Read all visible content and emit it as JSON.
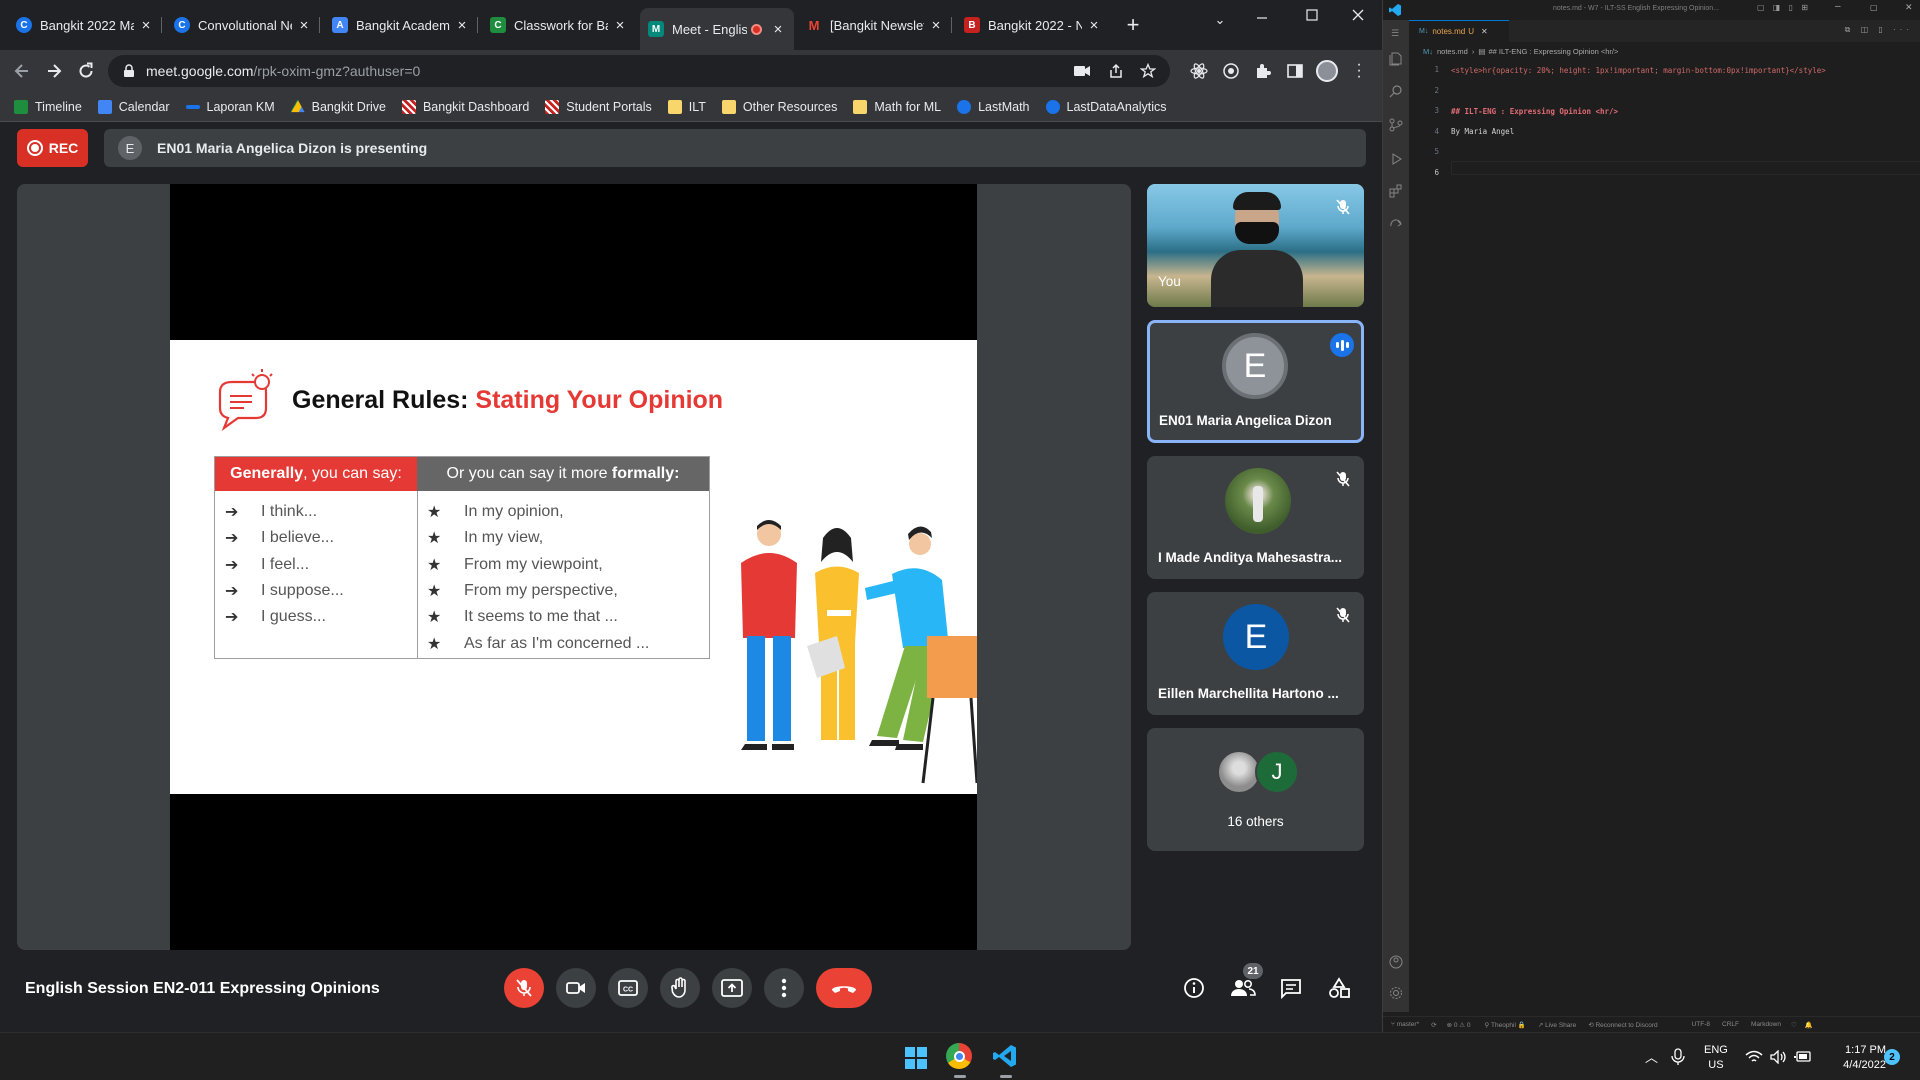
{
  "browser": {
    "tabs": [
      {
        "label": "Bangkit 2022 Ma...",
        "fav": "C",
        "color": "#1a73e8"
      },
      {
        "label": "Convolutional Ne...",
        "fav": "C",
        "color": "#1a73e8"
      },
      {
        "label": "Bangkit Academy...",
        "fav": "A",
        "color": "#4285f4"
      },
      {
        "label": "Classwork for Ba...",
        "fav": "C",
        "color": "#1e8e3e"
      },
      {
        "label": "Meet - Englis...",
        "fav": "M",
        "color": "#00897b"
      },
      {
        "label": "[Bangkit Newslet...",
        "fav": "M",
        "color": "#ea4335"
      },
      {
        "label": "Bangkit 2022 - N...",
        "fav": "B",
        "color": "#c5221f"
      }
    ],
    "url_host": "meet.google.com",
    "url_path": "/rpk-oxim-gmz?authuser=0",
    "bookmarks": [
      "Timeline",
      "Calendar",
      "Laporan KM",
      "Bangkit Drive",
      "Bangkit Dashboard",
      "Student Portals",
      "ILT",
      "Other Resources",
      "Math for ML",
      "LastMath",
      "LastDataAnalytics"
    ]
  },
  "meet": {
    "rec_label": "REC",
    "presenter_initial": "E",
    "presenting_text": "EN01 Maria Angelica Dizon is presenting",
    "meeting_title": "English Session EN2-011 Expressing Opinions",
    "people_count": "21",
    "participants": [
      {
        "name": "You"
      },
      {
        "name": "EN01 Maria Angelica Dizon",
        "initial": "E"
      },
      {
        "name": "I Made Anditya Mahesastra..."
      },
      {
        "name": "Eillen Marchellita Hartono ...",
        "initial": "E"
      },
      {
        "name": "16 others",
        "initial": "J"
      }
    ]
  },
  "slide": {
    "title_a": "General Rules:",
    "title_b": "Stating Your Opinion",
    "col1_head_bold": "Generally",
    "col1_head_rest": ", you can say:",
    "col2_head_pre": "Or you can say it more ",
    "col2_head_bold": "formally:",
    "col1_items": [
      "I think...",
      "I believe...",
      "I feel...",
      "I suppose...",
      "I guess..."
    ],
    "col2_items": [
      "In my opinion,",
      "In my view,",
      "From my viewpoint,",
      "From my perspective,",
      "It seems to me that ...",
      "As far as I'm concerned ..."
    ]
  },
  "editor": {
    "window_title": "notes.md - W7 - ILT-SS English Expressing Opinion...",
    "tab": "notes.md",
    "tab_state": "U",
    "breadcrumb_file": "notes.md",
    "breadcrumb_section": "## ILT-ENG : Expressing Opinion <hr/>",
    "line1": "<style>hr{opacity: 20%; height: 1px!important; margin-bottom:0px!important}</style>",
    "line3": "## ILT-ENG : Expressing Opinion <hr/>",
    "line4": "By Maria Angel",
    "status": {
      "branch": "master*",
      "errors": "0",
      "warnings": "0",
      "user": "Theophil",
      "liveshare": "Live Share",
      "discord": "Reconnect to Discord",
      "enc": "UTF-8",
      "eol": "CRLF",
      "lang": "Markdown"
    }
  },
  "taskbar": {
    "lang": "ENG",
    "region": "US",
    "time": "1:17 PM",
    "date": "4/4/2022",
    "notif": "2"
  }
}
